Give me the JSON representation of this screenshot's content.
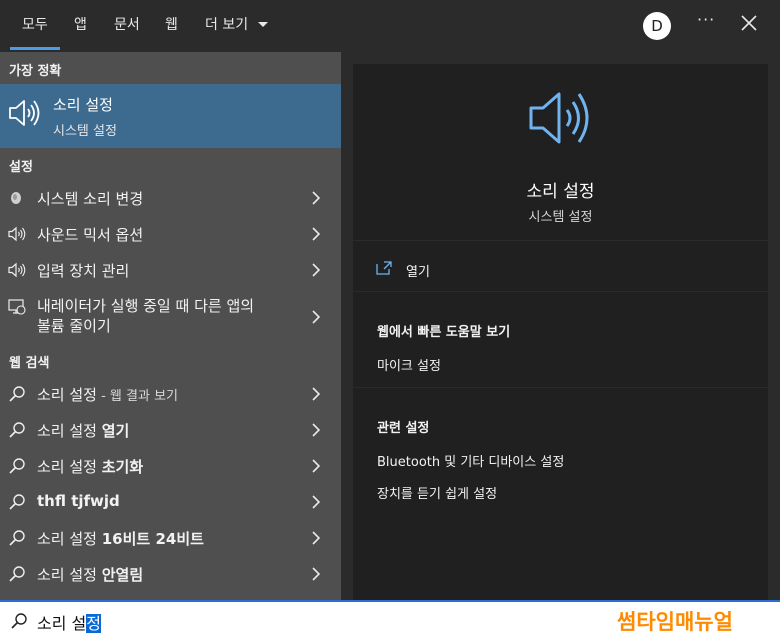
{
  "tabs": [
    {
      "label": "모두",
      "active": true
    },
    {
      "label": "앱"
    },
    {
      "label": "문서"
    },
    {
      "label": "웹"
    },
    {
      "label": "더 보기"
    }
  ],
  "header": {
    "avatar_letter": "D",
    "more_label": "···"
  },
  "left": {
    "best_match_heading": "가장 정확",
    "best_match": {
      "title": "소리 설정",
      "subtitle": "시스템 설정",
      "icon": "speaker-icon"
    },
    "settings_heading": "설정",
    "settings_items": [
      {
        "label": "시스템 소리 변경",
        "icon": "sound-knob-icon"
      },
      {
        "label": "사운드 믹서 옵션",
        "icon": "speaker-icon"
      },
      {
        "label": "입력 장치 관리",
        "icon": "speaker-icon"
      },
      {
        "line1": "내레이터가 실행 중일 때 다른 앱의",
        "line2": "볼륨 줄이기",
        "icon": "monitor-icon"
      }
    ],
    "web_heading": "웹 검색",
    "web_items": [
      {
        "label": "소리 설정",
        "suffix": " - 웹 결과 보기"
      },
      {
        "label": "소리 설정 ",
        "bold": "열기"
      },
      {
        "label": "소리 설정 ",
        "bold": "초기화"
      },
      {
        "label": "",
        "bold": "thfl tjfwjd"
      },
      {
        "label": "소리 설정 ",
        "bold": "16비트 24비트"
      },
      {
        "label": "소리 설정 ",
        "bold": "안열림"
      }
    ]
  },
  "right": {
    "title": "소리 설정",
    "subtitle": "시스템 설정",
    "open_label": "열기",
    "web_help_heading": "웹에서 빠른 도움말 보기",
    "web_help_items": [
      "마이크 설정"
    ],
    "related_heading": "관련 설정",
    "related_items": [
      "Bluetooth 및 기타 디바이스 설정",
      "장치를 듣기 쉽게 설정"
    ]
  },
  "search": {
    "typed": "소리 설",
    "selected": "정"
  },
  "watermark": "썸타임매뉴얼",
  "colors": {
    "accent": "#2a6fd1",
    "selected_row": "#3d6a8f",
    "brand": "#ff8a00"
  }
}
